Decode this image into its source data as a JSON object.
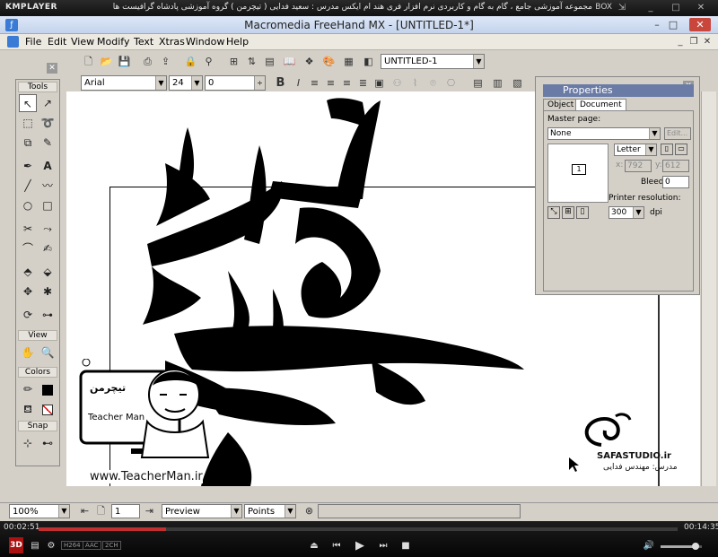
{
  "player": {
    "logo": "KMPLAYER",
    "caption": "مجموعه آموزشی جامع ، گام به گام و کاربردی نرم افزار فری هند ام ایکس   مدرس : سعید فدایی ( تیچرمن ) گروه آموزشی پادشاه گرافیست ها",
    "box_label": "BOX",
    "time_elapsed": "00:02:51",
    "time_total": "00:14:35",
    "progress": 0.2,
    "volume": 0.85,
    "badges": [
      "H264",
      "AAC",
      "2CH"
    ],
    "badge_3d": "3D"
  },
  "app": {
    "title": "Macromedia FreeHand MX - [UNTITLED-1*]",
    "menu": [
      "File",
      "Edit",
      "View",
      "Modify",
      "Text",
      "Xtras",
      "Window",
      "Help"
    ]
  },
  "toolbar": {
    "document_select": "UNTITLED-1",
    "font_name": "Arial",
    "font_size": "24",
    "baseline_value": "0",
    "bold_label": "B"
  },
  "tools_panel": {
    "headers": {
      "tools": "Tools",
      "view": "View",
      "colors": "Colors",
      "snap": "Snap"
    }
  },
  "properties": {
    "title": "Properties",
    "tabs": [
      "Object",
      "Document"
    ],
    "master_page_label": "Master page:",
    "master_page_value": "None",
    "edit_label": "Edit...",
    "page_count": "1",
    "page_size": "Letter",
    "width_label": "x:",
    "width_value": "792",
    "height_label": "y:",
    "height_value": "612",
    "bleed_label": "Bleed:",
    "bleed_value": "0",
    "printer_res_label": "Printer resolution:",
    "printer_res_value": "300",
    "dpi_label": "dpi"
  },
  "status": {
    "zoom": "100%",
    "page": "1",
    "view_mode": "Preview",
    "units": "Points"
  },
  "overlays": {
    "teacherman_url": "www.TeacherMan.ir",
    "teacherman_name": "Teacher Man",
    "safastudio": "SAFASTUDIO.ir",
    "safastudio_sub": "مدرس: مهندس فدایی"
  }
}
